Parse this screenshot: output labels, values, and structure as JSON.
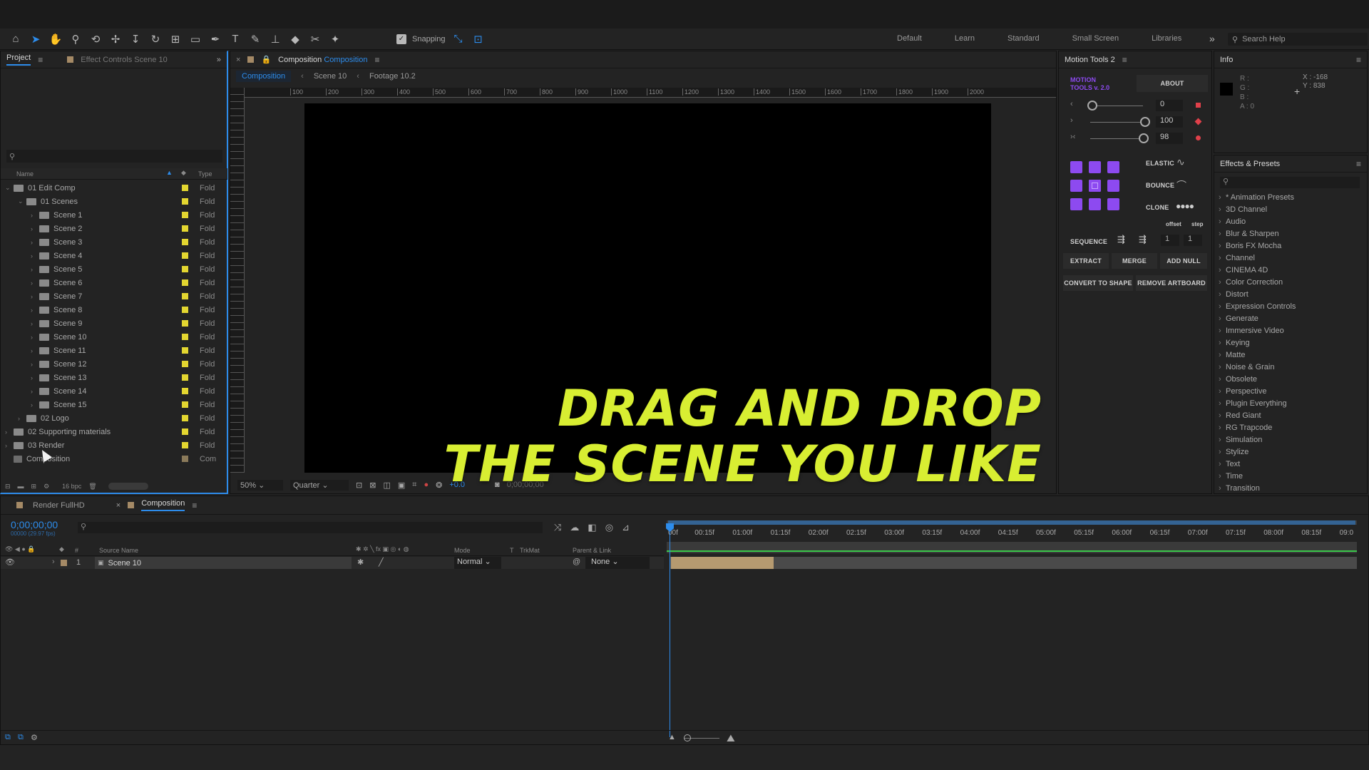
{
  "toolbar": {
    "snapping_label": "Snapping",
    "workspaces": [
      "Default",
      "Learn",
      "Standard",
      "Small Screen",
      "Libraries"
    ],
    "search_placeholder": "Search Help"
  },
  "project_panel": {
    "tab_project": "Project",
    "tab_effect_controls": "Effect Controls Scene 10",
    "col_name": "Name",
    "col_type": "Type",
    "items": [
      {
        "name": "01 Edit Comp",
        "type": "Fold"
      },
      {
        "name": "01 Scenes",
        "type": "Fold"
      },
      {
        "name": "Scene 1",
        "type": "Fold"
      },
      {
        "name": "Scene 2",
        "type": "Fold"
      },
      {
        "name": "Scene 3",
        "type": "Fold"
      },
      {
        "name": "Scene 4",
        "type": "Fold"
      },
      {
        "name": "Scene 5",
        "type": "Fold"
      },
      {
        "name": "Scene 6",
        "type": "Fold"
      },
      {
        "name": "Scene 7",
        "type": "Fold"
      },
      {
        "name": "Scene 8",
        "type": "Fold"
      },
      {
        "name": "Scene 9",
        "type": "Fold"
      },
      {
        "name": "Scene 10",
        "type": "Fold"
      },
      {
        "name": "Scene 11",
        "type": "Fold"
      },
      {
        "name": "Scene 12",
        "type": "Fold"
      },
      {
        "name": "Scene 13",
        "type": "Fold"
      },
      {
        "name": "Scene 14",
        "type": "Fold"
      },
      {
        "name": "Scene 15",
        "type": "Fold"
      },
      {
        "name": "02 Logo",
        "type": "Fold"
      },
      {
        "name": "02 Supporting materials",
        "type": "Fold"
      },
      {
        "name": "03 Render",
        "type": "Fold"
      },
      {
        "name": "Composition",
        "type": "Com"
      }
    ],
    "bpc": "16 bpc"
  },
  "viewer": {
    "panel_title": "Composition",
    "panel_title_accent": "Composition",
    "tabs": [
      "Composition",
      "Scene 10",
      "Footage 10.2"
    ],
    "ruler_labels": [
      "100",
      "200",
      "300",
      "400",
      "500",
      "600",
      "700",
      "800",
      "900",
      "1000",
      "1100",
      "1200",
      "1300",
      "1400",
      "1500",
      "1600",
      "1700",
      "1800",
      "1900",
      "2000"
    ],
    "zoom": "50%",
    "resolution": "Quarter",
    "exposure": "+0.0",
    "timecode": "0;00;00;00"
  },
  "motion_tools": {
    "title": "Motion Tools 2",
    "logo_line1": "MOTION",
    "logo_line2": "TOOLS v. 2.0",
    "about": "ABOUT",
    "slider_values": [
      "0",
      "100",
      "98"
    ],
    "elastic": "ELASTIC",
    "bounce": "BOUNCE",
    "clone": "CLONE",
    "offset": "offset",
    "step": "step",
    "sequence": "SEQUENCE",
    "seq_offset": "1",
    "seq_step": "1",
    "extract": "EXTRACT",
    "merge": "MERGE",
    "add_null": "ADD NULL",
    "convert_to_shape": "CONVERT TO SHAPE",
    "remove_artboard": "REMOVE ARTBOARD",
    "accent_color": "#8d4af0"
  },
  "info": {
    "title": "Info",
    "r": "R :",
    "g": "G :",
    "b": "B :",
    "a": "A : 0",
    "x": "X : -168",
    "y": "Y : 838"
  },
  "effects": {
    "title": "Effects & Presets",
    "items": [
      "* Animation Presets",
      "3D Channel",
      "Audio",
      "Blur & Sharpen",
      "Boris FX Mocha",
      "Channel",
      "CINEMA 4D",
      "Color Correction",
      "Distort",
      "Expression Controls",
      "Generate",
      "Immersive Video",
      "Keying",
      "Matte",
      "Noise & Grain",
      "Obsolete",
      "Perspective",
      "Plugin Everything",
      "Red Giant",
      "RG Trapcode",
      "Simulation",
      "Stylize",
      "Text",
      "Time",
      "Transition"
    ]
  },
  "timeline": {
    "tab_render": "Render FullHD",
    "tab_comp": "Composition",
    "timecode": "0;00;00;00",
    "frames": "00000 (29.97 fps)",
    "col_source": "Source Name",
    "col_mode": "Mode",
    "col_t": "T",
    "col_trkmat": "TrkMat",
    "col_parent": "Parent & Link",
    "layer_num": "1",
    "layer_name": "Scene 10",
    "layer_mode": "Normal",
    "layer_parent": "None",
    "ruler": [
      "00f",
      "00:15f",
      "01:00f",
      "01:15f",
      "02:00f",
      "02:15f",
      "03:00f",
      "03:15f",
      "04:00f",
      "04:15f",
      "05:00f",
      "05:15f",
      "06:00f",
      "06:15f",
      "07:00f",
      "07:15f",
      "08:00f",
      "08:15f",
      "09:0"
    ]
  },
  "caption": {
    "line1": "DRAG AND DROP",
    "line2": "THE SCENE YOU LIKE",
    "color": "#d8ee32"
  }
}
